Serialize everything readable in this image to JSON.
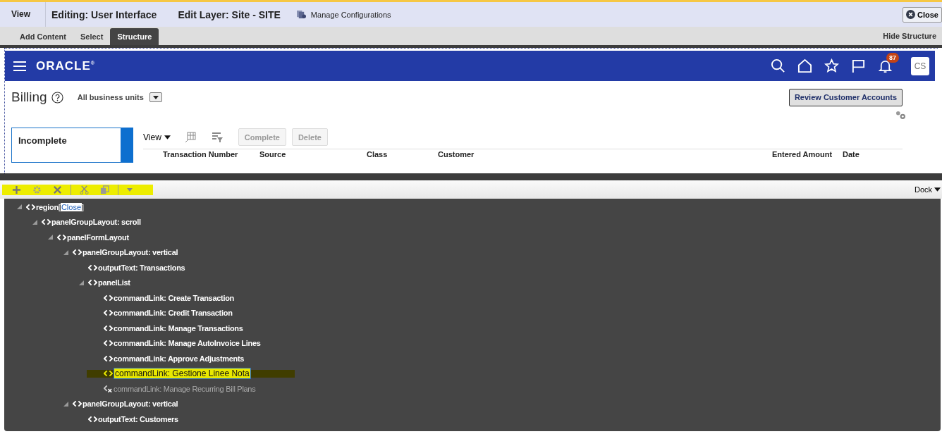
{
  "editor_bar": {
    "view_label": "View",
    "editing": "Editing: User Interface",
    "edit_layer": "Edit Layer: Site - SITE",
    "manage_configurations": "Manage Configurations",
    "close_button": "Close"
  },
  "tabs": [
    {
      "label": "Add Content",
      "selected": false
    },
    {
      "label": "Select",
      "selected": false
    },
    {
      "label": "Structure",
      "selected": true
    }
  ],
  "hide_structure": "Hide Structure",
  "app_header": {
    "logo": "ORACLE$^{®}$",
    "notification_count": "87",
    "avatar_initials": "CS"
  },
  "billing": {
    "title": "Billing",
    "business_unit": "All business units",
    "review_button": "Review Customer Accounts"
  },
  "incomplete_card": {
    "title": "Incomplete"
  },
  "table_toolbar": {
    "view_menu": "View",
    "buttons": [
      {
        "label": "Complete",
        "disabled": true
      },
      {
        "label": "Delete",
        "disabled": true
      }
    ]
  },
  "table": {
    "columns": [
      "Transaction Number",
      "Source",
      "Class",
      "Customer",
      "Entered Amount",
      "Date"
    ]
  },
  "structure_toolbar": {
    "dock": "Dock"
  },
  "tree": [
    {
      "label": "region",
      "link_open": "[",
      "link": "Close",
      "link_close": "]",
      "expanded": true,
      "selected": false,
      "disabled": false,
      "children": [
        {
          "label": "panelGroupLayout: scroll",
          "expanded": true,
          "selected": false,
          "disabled": false,
          "children": [
            {
              "label": "panelFormLayout",
              "expanded": true,
              "selected": false,
              "disabled": false,
              "children": [
                {
                  "label": "panelGroupLayout: vertical",
                  "expanded": true,
                  "selected": false,
                  "disabled": false,
                  "children": [
                    {
                      "label": "outputText: Transactions",
                      "selected": false,
                      "disabled": false
                    },
                    {
                      "label": "panelList",
                      "expanded": true,
                      "selected": false,
                      "disabled": false,
                      "children": [
                        {
                          "label": "commandLink: Create Transaction",
                          "selected": false,
                          "disabled": false
                        },
                        {
                          "label": "commandLink: Credit Transaction",
                          "selected": false,
                          "disabled": false
                        },
                        {
                          "label": "commandLink: Manage Transactions",
                          "selected": false,
                          "disabled": false
                        },
                        {
                          "label": "commandLink: Manage AutoInvoice Lines",
                          "selected": false,
                          "disabled": false
                        },
                        {
                          "label": "commandLink: Approve Adjustments",
                          "selected": false,
                          "disabled": false
                        },
                        {
                          "label": "commandLink: Gestione Linee Nota",
                          "selected": true,
                          "disabled": false
                        },
                        {
                          "label": "commandLink: Manage Recurring Bill Plans",
                          "selected": false,
                          "disabled": true
                        }
                      ]
                    }
                  ]
                },
                {
                  "label": "panelGroupLayout: vertical",
                  "expanded": true,
                  "selected": false,
                  "disabled": false,
                  "children": [
                    {
                      "label": "outputText: Customers",
                      "selected": false,
                      "disabled": false
                    }
                  ]
                }
              ]
            }
          ]
        }
      ]
    }
  ]
}
